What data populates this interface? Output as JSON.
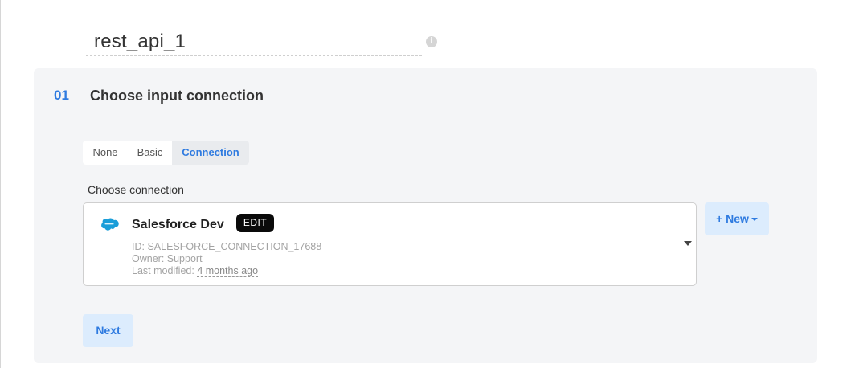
{
  "title_field": {
    "value": "rest_api_1",
    "info_icon": "info-icon"
  },
  "step": {
    "number": "01",
    "title": "Choose input connection"
  },
  "tabs": [
    {
      "label": "None",
      "selected": false
    },
    {
      "label": "Basic",
      "selected": false
    },
    {
      "label": "Connection",
      "selected": true
    }
  ],
  "connection": {
    "label": "Choose connection",
    "selected": {
      "icon": "salesforce-icon",
      "name": "Salesforce Dev",
      "edit_label": "EDIT",
      "id_text": "ID: SALESFORCE_CONNECTION_17688",
      "owner_text": "Owner: Support",
      "modified_prefix": "Last modified:",
      "modified_value": "4 months ago"
    },
    "dropdown_icon": "caret-down-icon"
  },
  "new_button": {
    "label": "+ New"
  },
  "next_button": {
    "label": "Next"
  },
  "colors": {
    "accent": "#2f7be0",
    "card_bg": "#f4f5f7",
    "button_bg": "#dcecfd",
    "salesforce_blue": "#1a9ed9"
  }
}
